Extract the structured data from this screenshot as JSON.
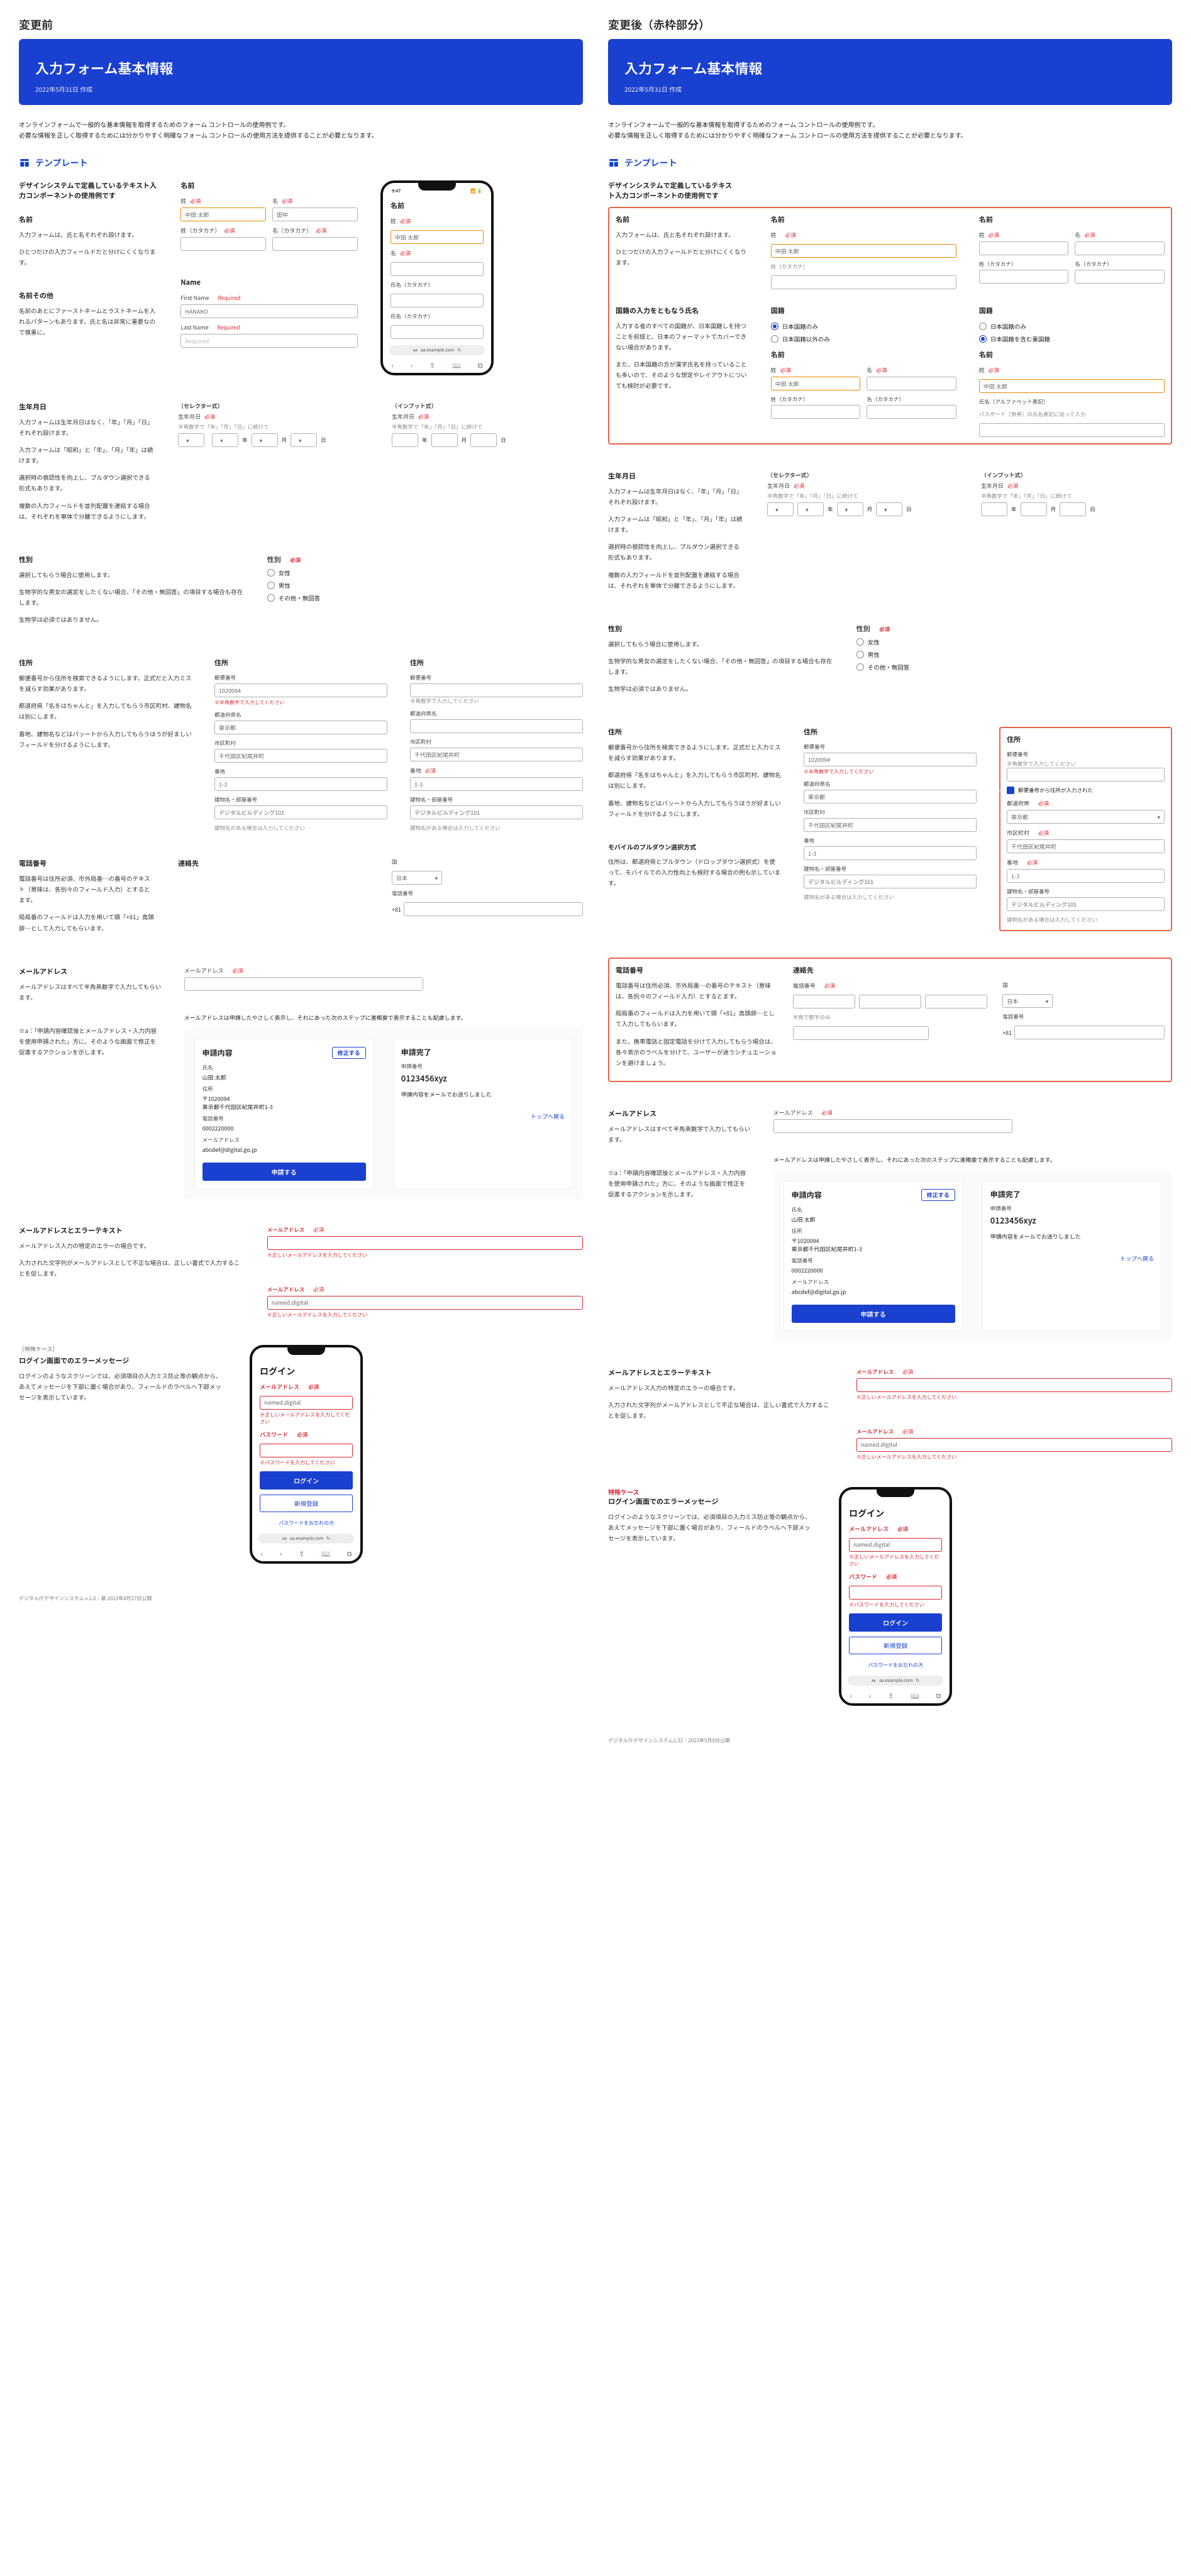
{
  "left_heading": "変更前",
  "right_heading": "変更後（赤枠部分）",
  "hero": {
    "title": "入力フォーム基本情報",
    "date": "2022年5月31日 作成"
  },
  "intro_line1": "オンラインフォームで一般的な基本情報を取得するためのフォーム コントロールの使用例です。",
  "intro_line2": "必要な情報を正しく取得するためには分かりやすく明確なフォーム コントロールの使用方法を提供することが必要となります。",
  "tpl_title": "テンプレート",
  "name_block": {
    "desc_h": "デザインシステムで定義しているテキスト入力コンポーネントの使用例です",
    "h": "名前",
    "p1": "入力フォームは、氏と名それぞれ設けます。",
    "p2": "ひとつだけの入力フィールドだと分けにくくなります。",
    "other_h": "名前その他",
    "other_p": "名前のあとにファーストネームとラストネームを入れるパターンもあります。氏と名は非常に重要なので慎重に。",
    "labels": {
      "title": "名前",
      "sei": "姓",
      "mei": "名",
      "sei_kana": "姓（カタカナ）",
      "mei_kana": "名（カタカナ）",
      "req": "必須",
      "ph_sei": "中田 太郎",
      "ph_mei": "田中",
      "ph_seikana": "",
      "ph_meikana": "",
      "name_en": "Name",
      "first": "First Name",
      "last": "Last Name",
      "required": "Required",
      "ph_first": "HANAKO",
      "ph_last": "Required"
    },
    "phone": {
      "time": "9:47",
      "title": "名前",
      "sei": "姓",
      "mei": "名",
      "req": "必須",
      "ph_sei": "中田 太郎",
      "mei_val": "",
      "kana_title": "氏名（カタカナ）",
      "ph_kana": "",
      "kana2_title": "氏名（カタカナ）",
      "url": "aa.example.com"
    }
  },
  "nat_block": {
    "desc_h": "国籍の入力をともなう氏名",
    "desc_p1": "入力する者のすべての国籍が、日本国籍しを持つことを前提と、日本のフォーマットでカバーできない場合があります。",
    "desc_p2": "また、日本国籍の方が漢字氏名を持っていることも多いので、そのような想定やレイアウトについても検討が必要です。",
    "nat_h": "国籍",
    "r1": "日本国籍のみ",
    "r2": "日本国籍以外のみ",
    "r3": "日本国籍を含む重国籍",
    "name_h": "名前",
    "sei": "姓",
    "mei": "名",
    "req": "必須",
    "ph_sei": "中田 太郎",
    "ph_mei": "",
    "sei_kana": "姓（カタカナ）",
    "mei_kana": "名（カタカナ）",
    "alpha_name": "氏名（アルファベット表記）",
    "alpha_hint": "パスポート（旅券）の氏名表記に従って入力"
  },
  "dob_block": {
    "h": "生年月日",
    "p1": "入力フォームは生年月日はなく、「年」「月」「日」それぞれ設けます。",
    "p2": "入力フォームは「昭和」と「年」、「月」「年」は続けます。",
    "p3": "選択時の視認性を向上し、プルダウン選択できる形式もあります。",
    "p4": "複数の入力フィールドを並列配置を連結する場合は、それぞれを単体で分離できるようにします。",
    "sel_h": "（セレクター式）",
    "inp_h": "（インプット式）",
    "label": "生年月日",
    "req": "必須",
    "hint": "半角数字で「年」「月」「日」に続けて",
    "y": "年",
    "m": "月",
    "d": "日"
  },
  "sex_block": {
    "h": "性別",
    "p1": "選択してもらう場合に使用します。",
    "p2": "生物学的な男女の選定をしたくない場合、「その他・無回答」の項目する場合も存在します。",
    "p3": "生物学は必須ではありません。",
    "label": "性別",
    "req": "必須",
    "r1": "女性",
    "r2": "男性",
    "r3": "その他・無回答"
  },
  "addr_block": {
    "h": "住所",
    "p1": "郵便番号から住所を検索できるようにします。正式だと入力ミスを減らす効果があります。",
    "p2": "都道府県「名をはちゃんと」を入力してもらう市区町村、建物名は別にします。",
    "p3": "番地、建物名などはパッートから入力してもらうほうが好ましいフィールドを分けるようにします。",
    "p4_h": "モバイルのプルダウン選択方式",
    "p4": "住所は、都道府県とプルダウン（ドロップダウン選択式）を使って、モバイルでの入力性向上も検討する場合の例も示しています。",
    "labels": {
      "zip": "郵便番号",
      "zip_val": "1020094",
      "zip_err": "※半角数字で入力してください",
      "pref": "都道府県名",
      "pref_val": "東京都",
      "city": "市区町村",
      "city_val": "千代田区紀尾井町",
      "banchi": "番地",
      "banchi_val": "1-3",
      "bld": "建物名・部屋番号",
      "bld_val": "デジタルビルディング101",
      "zip_hint": "半角数字で入力してください",
      "noaddr_chk": "郵便番号から住所が入力された",
      "pref_sel": "都道府県",
      "req": "必須",
      "hint_bld": "建物名がある場合は入力してください"
    }
  },
  "tel_block": {
    "h": "電話番号",
    "p1": "電話番号は住所必須、市外局番…の番号のテキスト（意味は、各別々のフィールド入力）とするとます。",
    "p2": "局局番のフィールドは入力を用いて頭「+81」高頭辞…として入力してもらいます。",
    "p3": "また、携帯電話と固定電話を分けて入力してもらう場合は、各々表示のラベルを分けて、ユーザーが迷うシチュエーションを避けましょう。",
    "contact_h": "連絡先",
    "tel_lbl": "電話番号",
    "tel_req": "必須",
    "tel_hint": "半角で数字のみ",
    "country": "国",
    "jp": "日本",
    "intl": "+81"
  },
  "mail_block": {
    "h": "メールアドレス",
    "p1": "メールアドレスはすべて半角英数字で入力してもらいます。",
    "note": "※a：「申請内容確認後とメールアドレス・入力内容を使用申請された」方に、そのような画面で修正を促進するアクションを示します。",
    "note2": "メールアドレスは申請したやさしく表示し、それにあった次のステップに進概要で表示することも配慮します。",
    "lbl": "メールアドレス",
    "req": "必須",
    "panel1": {
      "h": "申請内容",
      "edit": "修正する",
      "name_lbl": "氏名",
      "name_val": "山田 太郎",
      "addr_lbl": "住所",
      "addr_val": "〒1020094\n東京都千代田区紀尾井町1-3",
      "tel_lbl": "電話番号",
      "tel_val": "0002220000",
      "mail_lbl": "メールアドレス",
      "mail_val": "abcdef@digital.go.jp",
      "submit": "申請する"
    },
    "panel2": {
      "h": "申請完了",
      "num_lbl": "申請番号",
      "num_val": "0123456xyz",
      "msg": "申請内容をメールでお送りしました",
      "back": "トップへ戻る"
    }
  },
  "err_block": {
    "h": "メールアドレスとエラーテキスト",
    "p1": "メールアドレス入力の特定のエラーの場合です。",
    "p2": "入力された文字列がメールアドレスとして不正な場合は、正しい書式で入力することを促します。",
    "lbl1": "メールアドレス",
    "req": "必須",
    "err1": "※正しいメールアドレスを入力してください",
    "val2": "named.digital",
    "err2": "※正しいメールアドレスを入力してください"
  },
  "login_block": {
    "kicker": "［特殊ケース］",
    "kicker_red": "特殊ケース",
    "h": "ログイン画面でのエラーメッセージ",
    "p1": "ログインのようなスクリーンでは、必須項目の入力ミス防止等の観点から、あえてメッセージを下部に置く場合があり、フィールドのラベルへ下部メッセージを表示しています。",
    "login_h": "ログイン",
    "mail_lbl": "メールアドレス",
    "req": "必須",
    "mail_val": "named.digital",
    "mail_err": "※正しいメールアドレスを入力してください",
    "pw_lbl": "パスワード",
    "pw_err": "※パスワードを入力してください",
    "login_btn": "ログイン",
    "signup_btn": "新規登録",
    "forgot": "パスワードをお忘れの方",
    "url": "aa.example.com"
  },
  "footer_left": "デジタル庁デザインシステム v.1.0｜最 2023年4月27日公開",
  "footer_right": "デジタル庁デザインシステム1.32｜2023年5月X日公開"
}
